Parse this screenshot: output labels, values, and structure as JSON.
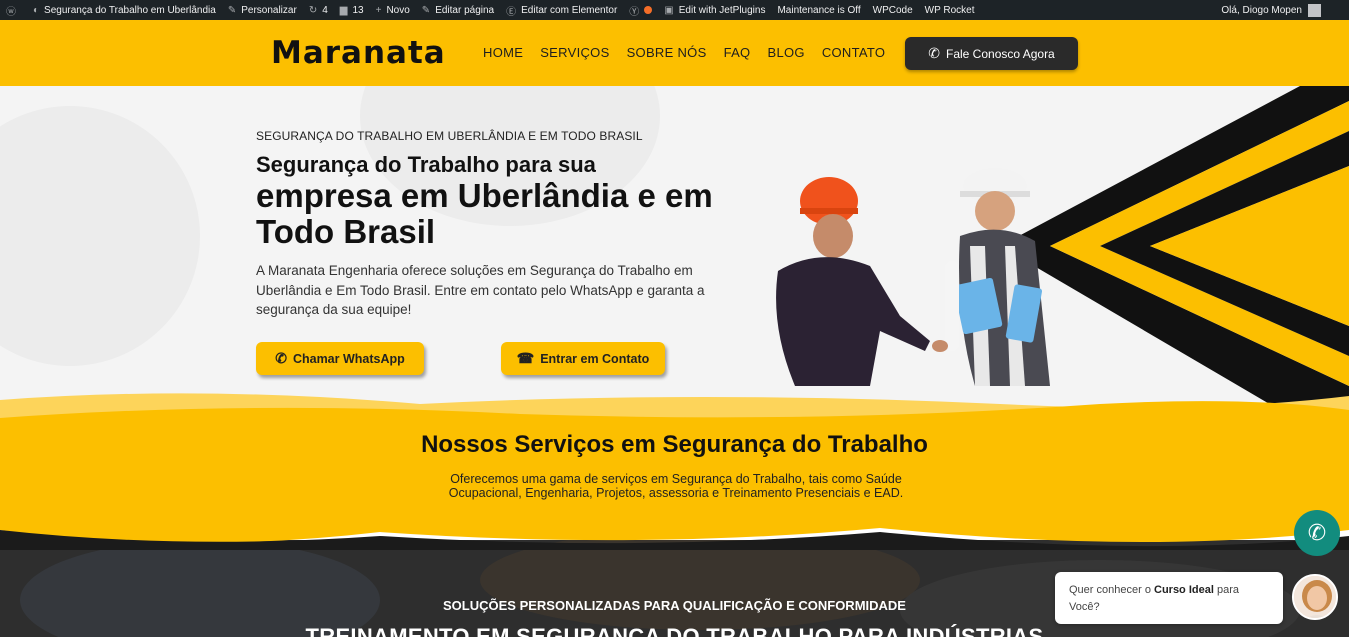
{
  "adminbar": {
    "items": [
      {
        "icon": "wordpress-icon",
        "label": ""
      },
      {
        "icon": "dashboard-icon",
        "label": "Segurança do Trabalho em Uberlândia"
      },
      {
        "icon": "brush-icon",
        "label": "Personalizar"
      },
      {
        "icon": "updates-icon",
        "label": "4"
      },
      {
        "icon": "comments-icon",
        "label": "13"
      },
      {
        "icon": "plus-icon",
        "label": "Novo"
      },
      {
        "icon": "pencil-icon",
        "label": "Editar página"
      },
      {
        "icon": "elementor-icon",
        "label": "Editar com Elementor"
      },
      {
        "icon": "yoast-icon",
        "label": ""
      },
      {
        "icon": "jet-icon",
        "label": "Edit with JetPlugins"
      },
      {
        "icon": "",
        "label": "Maintenance is Off"
      },
      {
        "icon": "",
        "label": "WPCode"
      },
      {
        "icon": "",
        "label": "WP Rocket"
      }
    ],
    "greeting": "Olá, Diogo Mopen"
  },
  "header": {
    "logo": "Maranata",
    "nav": [
      "HOME",
      "SERVIÇOS",
      "SOBRE NÓS",
      "FAQ",
      "BLOG",
      "CONTATO"
    ],
    "cta": "Fale Conosco Agora"
  },
  "hero": {
    "eyebrow": "SEGURANÇA DO TRABALHO EM UBERLÂNDIA E EM TODO BRASIL",
    "title_small": "Segurança do Trabalho para sua",
    "title_big": "empresa em Uberlândia e em Todo Brasil",
    "paragraph": "A Maranata Engenharia oferece soluções em Segurança do Trabalho em Uberlândia e Em Todo Brasil. Entre em contato pelo WhatsApp e garanta a segurança da sua equipe!",
    "btn_whatsapp": "Chamar WhatsApp",
    "btn_contact": "Entrar em Contato"
  },
  "services": {
    "title": "Nossos Serviços em Segurança do Trabalho",
    "description": "Oferecemos uma gama de serviços em Segurança do Trabalho, tais como Saúde Ocupacional, Engenharia, Projetos, assessoria e Treinamento Presenciais e EAD."
  },
  "training": {
    "subtitle": "SOLUÇÕES PERSONALIZADAS PARA QUALIFICAÇÃO E CONFORMIDADE",
    "title": "TREINAMENTO EM SEGURANÇA DO TRABALHO PARA INDÚSTRIAS"
  },
  "chat": {
    "text_before": "Quer conhecer o ",
    "text_bold": "Curso Ideal",
    "text_after": " para Você?"
  },
  "colors": {
    "brand_yellow": "#fcbf00",
    "dark": "#2a2a2a",
    "whatsapp_green": "#128c7e"
  }
}
